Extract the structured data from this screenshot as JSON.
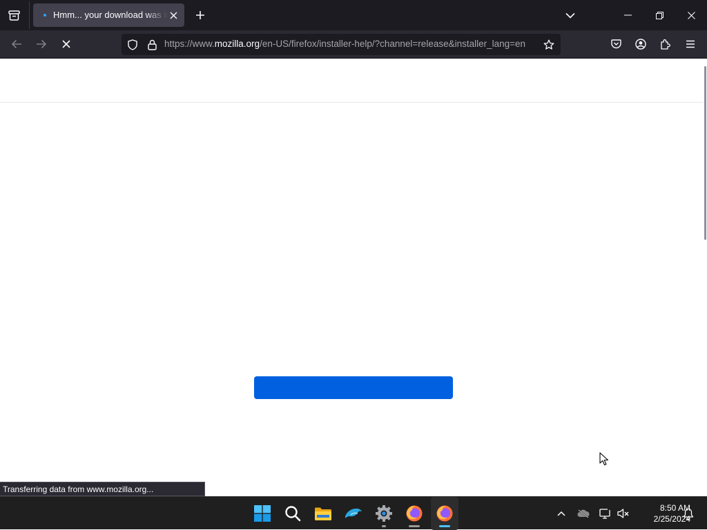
{
  "browser": {
    "tab": {
      "title": "Hmm... your download was interrupted"
    },
    "url": {
      "scheme": "https://www.",
      "host": "mozilla.org",
      "path": "/en-US/firefox/installer-help/?channel=release&installer_lang=en"
    },
    "status_text": "Transferring data from www.mozilla.org..."
  },
  "colors": {
    "accent_blue": "#0060df",
    "chrome_dark": "#1c1b22",
    "toolbar": "#2b2a33"
  },
  "taskbar": {
    "apps": [
      {
        "name": "start-icon"
      },
      {
        "name": "search-icon"
      },
      {
        "name": "file-explorer-icon"
      },
      {
        "name": "dolphin-emulator-icon"
      },
      {
        "name": "settings-icon"
      },
      {
        "name": "firefox-icon"
      },
      {
        "name": "firefox-icon-active"
      }
    ],
    "clock": {
      "time": "8:50 AM",
      "date": "2/25/2024"
    }
  }
}
